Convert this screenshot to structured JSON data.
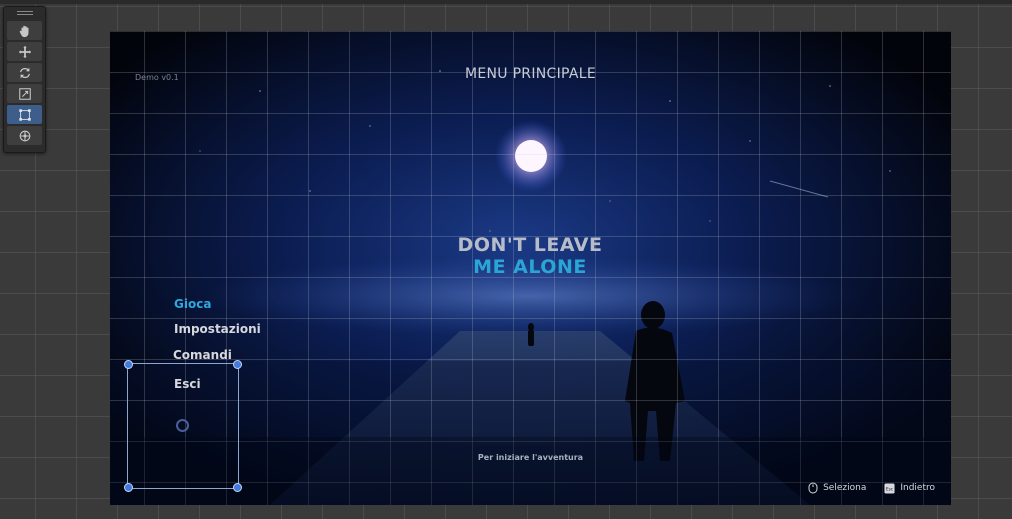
{
  "editor": {
    "tools": [
      {
        "name": "hand",
        "active": false
      },
      {
        "name": "move",
        "active": false
      },
      {
        "name": "rotate",
        "active": false
      },
      {
        "name": "scale",
        "active": false
      },
      {
        "name": "rect",
        "active": true
      },
      {
        "name": "transform",
        "active": false
      }
    ]
  },
  "game": {
    "version_label": "Demo v0.1",
    "menu_title": "MENU PRINCIPALE",
    "logo": {
      "line1": "DON'T LEAVE",
      "line2": "ME ALONE"
    },
    "menu_items": [
      {
        "label": "Gioca",
        "selected": true
      },
      {
        "label": "Impostazioni",
        "selected": false
      },
      {
        "label": "Comandi",
        "selected": false
      },
      {
        "label": "Esci",
        "selected": false
      }
    ],
    "hint": "Per iniziare l'avventura",
    "legend": {
      "select_label": "Seleziona",
      "back_key": "Esc",
      "back_label": "Indietro"
    }
  },
  "colors": {
    "accent": "#2fa8e0",
    "background": "#02040b",
    "editor_bg": "#3a3a3a",
    "selection": "#3f7be0"
  }
}
